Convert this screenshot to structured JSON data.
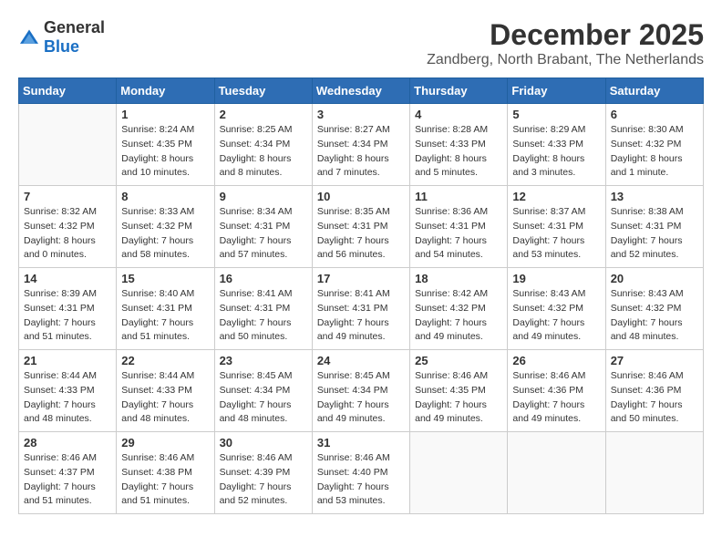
{
  "header": {
    "logo_general": "General",
    "logo_blue": "Blue",
    "month": "December 2025",
    "location": "Zandberg, North Brabant, The Netherlands"
  },
  "days_of_week": [
    "Sunday",
    "Monday",
    "Tuesday",
    "Wednesday",
    "Thursday",
    "Friday",
    "Saturday"
  ],
  "weeks": [
    [
      {
        "day": "",
        "info": ""
      },
      {
        "day": "1",
        "info": "Sunrise: 8:24 AM\nSunset: 4:35 PM\nDaylight: 8 hours\nand 10 minutes."
      },
      {
        "day": "2",
        "info": "Sunrise: 8:25 AM\nSunset: 4:34 PM\nDaylight: 8 hours\nand 8 minutes."
      },
      {
        "day": "3",
        "info": "Sunrise: 8:27 AM\nSunset: 4:34 PM\nDaylight: 8 hours\nand 7 minutes."
      },
      {
        "day": "4",
        "info": "Sunrise: 8:28 AM\nSunset: 4:33 PM\nDaylight: 8 hours\nand 5 minutes."
      },
      {
        "day": "5",
        "info": "Sunrise: 8:29 AM\nSunset: 4:33 PM\nDaylight: 8 hours\nand 3 minutes."
      },
      {
        "day": "6",
        "info": "Sunrise: 8:30 AM\nSunset: 4:32 PM\nDaylight: 8 hours\nand 1 minute."
      }
    ],
    [
      {
        "day": "7",
        "info": "Sunrise: 8:32 AM\nSunset: 4:32 PM\nDaylight: 8 hours\nand 0 minutes."
      },
      {
        "day": "8",
        "info": "Sunrise: 8:33 AM\nSunset: 4:32 PM\nDaylight: 7 hours\nand 58 minutes."
      },
      {
        "day": "9",
        "info": "Sunrise: 8:34 AM\nSunset: 4:31 PM\nDaylight: 7 hours\nand 57 minutes."
      },
      {
        "day": "10",
        "info": "Sunrise: 8:35 AM\nSunset: 4:31 PM\nDaylight: 7 hours\nand 56 minutes."
      },
      {
        "day": "11",
        "info": "Sunrise: 8:36 AM\nSunset: 4:31 PM\nDaylight: 7 hours\nand 54 minutes."
      },
      {
        "day": "12",
        "info": "Sunrise: 8:37 AM\nSunset: 4:31 PM\nDaylight: 7 hours\nand 53 minutes."
      },
      {
        "day": "13",
        "info": "Sunrise: 8:38 AM\nSunset: 4:31 PM\nDaylight: 7 hours\nand 52 minutes."
      }
    ],
    [
      {
        "day": "14",
        "info": "Sunrise: 8:39 AM\nSunset: 4:31 PM\nDaylight: 7 hours\nand 51 minutes."
      },
      {
        "day": "15",
        "info": "Sunrise: 8:40 AM\nSunset: 4:31 PM\nDaylight: 7 hours\nand 51 minutes."
      },
      {
        "day": "16",
        "info": "Sunrise: 8:41 AM\nSunset: 4:31 PM\nDaylight: 7 hours\nand 50 minutes."
      },
      {
        "day": "17",
        "info": "Sunrise: 8:41 AM\nSunset: 4:31 PM\nDaylight: 7 hours\nand 49 minutes."
      },
      {
        "day": "18",
        "info": "Sunrise: 8:42 AM\nSunset: 4:32 PM\nDaylight: 7 hours\nand 49 minutes."
      },
      {
        "day": "19",
        "info": "Sunrise: 8:43 AM\nSunset: 4:32 PM\nDaylight: 7 hours\nand 49 minutes."
      },
      {
        "day": "20",
        "info": "Sunrise: 8:43 AM\nSunset: 4:32 PM\nDaylight: 7 hours\nand 48 minutes."
      }
    ],
    [
      {
        "day": "21",
        "info": "Sunrise: 8:44 AM\nSunset: 4:33 PM\nDaylight: 7 hours\nand 48 minutes."
      },
      {
        "day": "22",
        "info": "Sunrise: 8:44 AM\nSunset: 4:33 PM\nDaylight: 7 hours\nand 48 minutes."
      },
      {
        "day": "23",
        "info": "Sunrise: 8:45 AM\nSunset: 4:34 PM\nDaylight: 7 hours\nand 48 minutes."
      },
      {
        "day": "24",
        "info": "Sunrise: 8:45 AM\nSunset: 4:34 PM\nDaylight: 7 hours\nand 49 minutes."
      },
      {
        "day": "25",
        "info": "Sunrise: 8:46 AM\nSunset: 4:35 PM\nDaylight: 7 hours\nand 49 minutes."
      },
      {
        "day": "26",
        "info": "Sunrise: 8:46 AM\nSunset: 4:36 PM\nDaylight: 7 hours\nand 49 minutes."
      },
      {
        "day": "27",
        "info": "Sunrise: 8:46 AM\nSunset: 4:36 PM\nDaylight: 7 hours\nand 50 minutes."
      }
    ],
    [
      {
        "day": "28",
        "info": "Sunrise: 8:46 AM\nSunset: 4:37 PM\nDaylight: 7 hours\nand 51 minutes."
      },
      {
        "day": "29",
        "info": "Sunrise: 8:46 AM\nSunset: 4:38 PM\nDaylight: 7 hours\nand 51 minutes."
      },
      {
        "day": "30",
        "info": "Sunrise: 8:46 AM\nSunset: 4:39 PM\nDaylight: 7 hours\nand 52 minutes."
      },
      {
        "day": "31",
        "info": "Sunrise: 8:46 AM\nSunset: 4:40 PM\nDaylight: 7 hours\nand 53 minutes."
      },
      {
        "day": "",
        "info": ""
      },
      {
        "day": "",
        "info": ""
      },
      {
        "day": "",
        "info": ""
      }
    ]
  ]
}
